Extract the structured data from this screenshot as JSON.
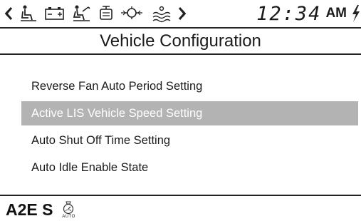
{
  "status_bar": {
    "icons": [
      "arrow-left-icon",
      "person-seat-icon",
      "battery-icon",
      "person-lever-icon",
      "engine-block-icon",
      "coolant-temp-icon",
      "water-waves-icon",
      "arrow-right-icon"
    ],
    "time": "12:34",
    "ampm": "AM",
    "indicator": "lightning-bolt-icon"
  },
  "header": {
    "title": "Vehicle Configuration"
  },
  "menu": {
    "items": [
      {
        "label": "Reverse Fan Auto Period Setting"
      },
      {
        "label": "Active LIS Vehicle Speed Setting",
        "selected": true
      },
      {
        "label": "Auto Shut Off Time Setting"
      },
      {
        "label": "Auto Idle Enable State"
      }
    ]
  },
  "footer": {
    "mode": "A2E S",
    "auto_label": "AUTO"
  },
  "colors": {
    "selection": "#b3b3b3",
    "text": "#1a1a1a",
    "background": "#ffffff"
  }
}
